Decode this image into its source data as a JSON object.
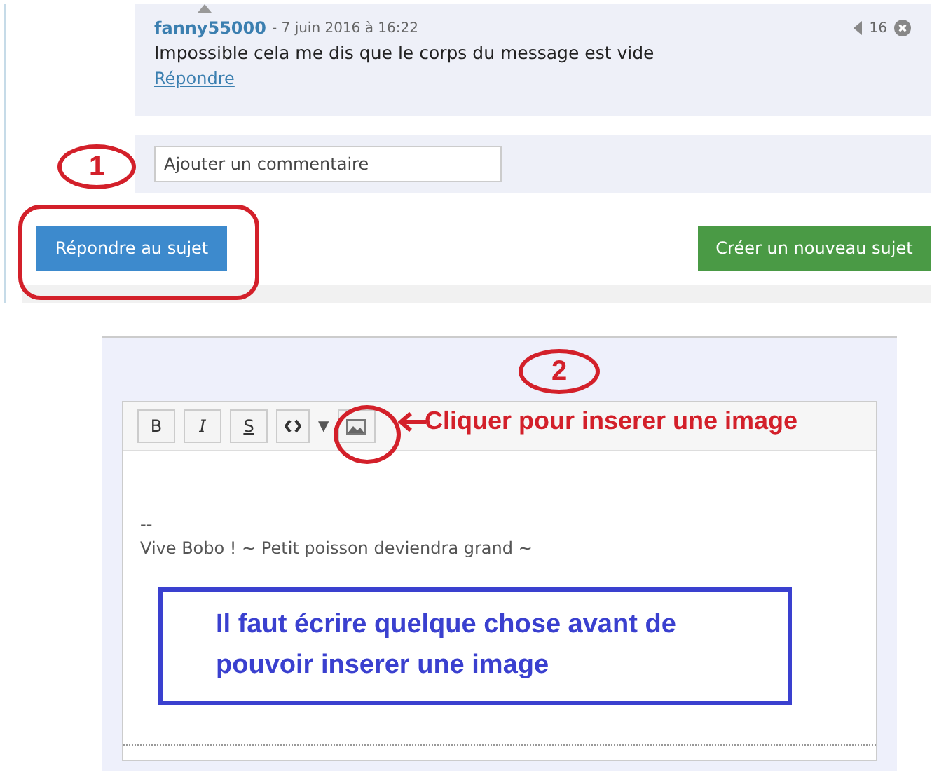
{
  "comment": {
    "author": "fanny55000",
    "date": "- 7 juin 2016 à 16:22",
    "votes": "16",
    "text": "Impossible cela me dis que le corps du message est vide",
    "reply_link": "Répondre"
  },
  "comment_field": {
    "placeholder": "Ajouter un commentaire"
  },
  "buttons": [
    {
      "label": "Répondre au sujet",
      "kind": "primary"
    },
    {
      "label": "Créer un nouveau sujet",
      "kind": "success"
    }
  ],
  "editor": {
    "toolbar": [
      {
        "kind": "bold",
        "label": "B"
      },
      {
        "kind": "italic",
        "label": "I"
      },
      {
        "kind": "strike",
        "label": "S"
      },
      {
        "kind": "code"
      },
      {
        "kind": "dropdown",
        "label": "▼"
      },
      {
        "kind": "image"
      }
    ],
    "lines": [
      "--",
      "Vive Bobo ! ~ Petit poisson deviendra grand ~"
    ]
  },
  "annotations": {
    "step_1": "1",
    "step_2": "2",
    "arrow_text": "Cliquer pour inserer une image",
    "note": "Il faut écrire quelque chose avant de pouvoir inserer une image"
  }
}
